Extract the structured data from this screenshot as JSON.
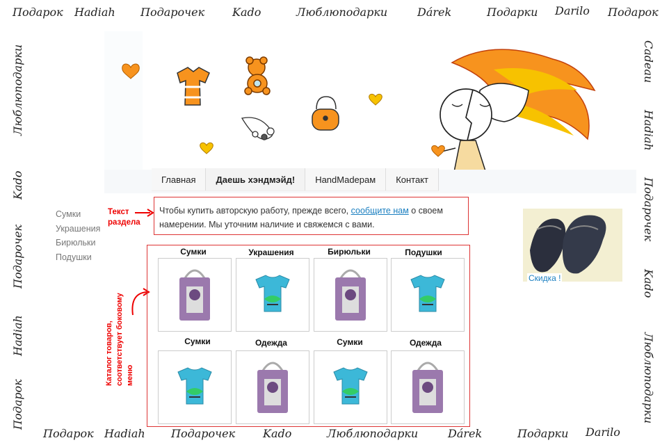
{
  "border_words": {
    "top": [
      "Подарок",
      "Hadiah",
      "Подарочек",
      "Kado",
      "Люблюподарки",
      "Dárek",
      "Подарки",
      "Darilo",
      "Подарок"
    ],
    "bottom": [
      "Подарок",
      "Hadiah",
      "Подарочек",
      "Kado",
      "Люблюподарки",
      "Dárek",
      "Подарки",
      "Darilo"
    ],
    "left": [
      "Люблюподарки",
      "Kado",
      "Подарочек",
      "Hadiah",
      "Подарок"
    ],
    "right": [
      "Cadeau",
      "Hadiah",
      "Подарочек",
      "Kado",
      "Люблюподарки"
    ]
  },
  "nav": {
    "items": [
      {
        "label": "Главная"
      },
      {
        "label": "Даешь хэндмэйд!"
      },
      {
        "label": "HandMadерам"
      },
      {
        "label": "Контакт"
      }
    ]
  },
  "side_menu": {
    "items": [
      "Сумки",
      "Украшения",
      "Бирюльки",
      "Подушки"
    ]
  },
  "annotations": {
    "section_text": "Текст раздела",
    "catalog_note": "Каталог товаров, соответствует боковому меню"
  },
  "intro": {
    "text_before": "Чтобы купить авторскую работу, прежде всего, ",
    "link": "сообщите нам",
    "text_after": " о своем намерении. Мы уточним наличие и свяжемся с вами."
  },
  "catalog": {
    "row1": [
      {
        "title": "Сумки",
        "image": "bag"
      },
      {
        "title": "Украшения",
        "image": "tshirt"
      },
      {
        "title": "Бирюльки",
        "image": "bag"
      },
      {
        "title": "Подушки",
        "image": "tshirt"
      }
    ],
    "row2": [
      {
        "title": "Сумки",
        "image": "tshirt"
      },
      {
        "title": "Одежда",
        "image": "bag"
      },
      {
        "title": "Сумки",
        "image": "tshirt"
      },
      {
        "title": "Одежда",
        "image": "bag"
      }
    ]
  },
  "promo": {
    "caption": "Скидка !"
  },
  "colors": {
    "accent_orange": "#f7931e",
    "annotation_red": "#e00000",
    "link_blue": "#1a7fc0"
  }
}
